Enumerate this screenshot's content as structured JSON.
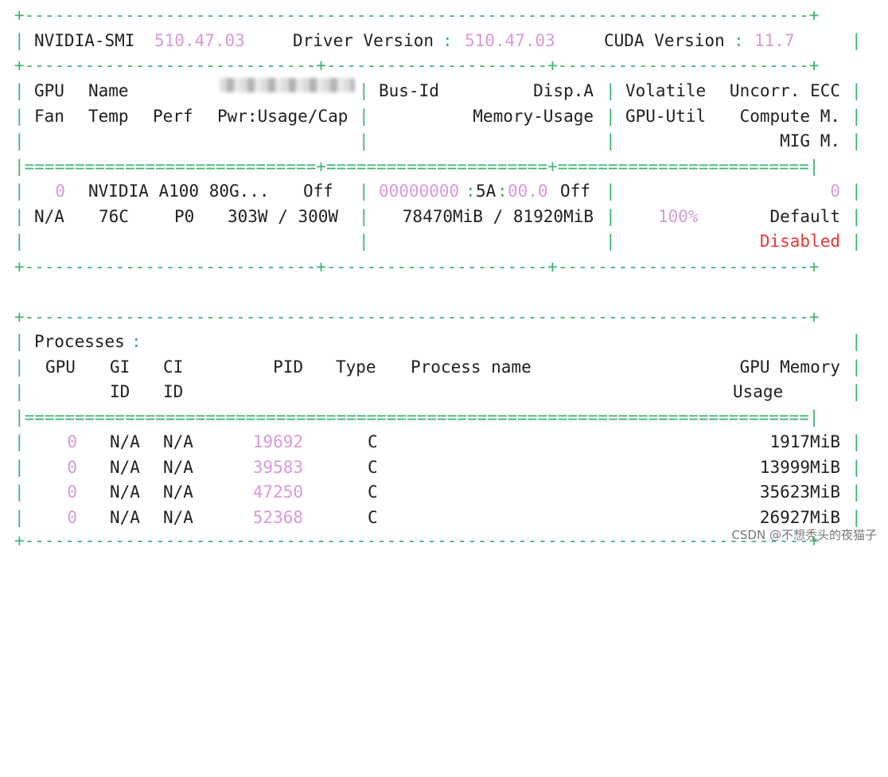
{
  "separators": {
    "dash": "+------------------------------------------------------------------------------+",
    "mid": "+-----------------------------+----------------------+-------------------------+",
    "equal": "|=============================+======================+=========================|",
    "equal_full": "|==============================================================================|"
  },
  "header": {
    "smi_label": "NVIDIA-SMI",
    "smi_version": "510.47.03",
    "driver_label": "Driver Version",
    "driver_version": "510.47.03",
    "cuda_label": "CUDA Version",
    "cuda_version": "11.7"
  },
  "gpu_table": {
    "col1_row1": [
      "GPU",
      "Name"
    ],
    "col1_row2": [
      "Fan",
      "Temp",
      "Perf",
      "Pwr:Usage/Cap"
    ],
    "col2_row1": [
      "Bus-Id",
      "Disp.A"
    ],
    "col2_row2": [
      "Memory-Usage"
    ],
    "col3_row1": [
      "Volatile",
      "Uncorr. ECC"
    ],
    "col3_row2": [
      "GPU-Util",
      "Compute M."
    ],
    "col3_row3": [
      "MIG M."
    ],
    "gpu": {
      "index": "0",
      "name": "NVIDIA A100 80G...",
      "persistence": "Off",
      "bus_id": "00000000:5A:00.0",
      "disp": "Off",
      "ecc": "0",
      "fan": "N/A",
      "temp": "76C",
      "perf": "P0",
      "power": "303W / 300W",
      "memory": "78470MiB / 81920MiB",
      "util": "100%",
      "compute_mode": "Default",
      "mig_mode": "Disabled"
    }
  },
  "processes": {
    "title": "Processes",
    "headers": {
      "gpu": "GPU",
      "gi": "GI",
      "ci": "CI",
      "gi_sub": "ID",
      "ci_sub": "ID",
      "pid": "PID",
      "type": "Type",
      "process_name": "Process name",
      "mem": "GPU Memory",
      "mem_sub": "Usage"
    },
    "rows": [
      {
        "gpu": "0",
        "gi": "N/A",
        "ci": "N/A",
        "pid": "19692",
        "type": "C",
        "name": "",
        "mem": "1917MiB"
      },
      {
        "gpu": "0",
        "gi": "N/A",
        "ci": "N/A",
        "pid": "39583",
        "type": "C",
        "name": "",
        "mem": "13999MiB"
      },
      {
        "gpu": "0",
        "gi": "N/A",
        "ci": "N/A",
        "pid": "47250",
        "type": "C",
        "name": "",
        "mem": "35623MiB"
      },
      {
        "gpu": "0",
        "gi": "N/A",
        "ci": "N/A",
        "pid": "52368",
        "type": "C",
        "name": "",
        "mem": "26927MiB"
      }
    ]
  },
  "watermark": "CSDN @不想秃头的夜猫子",
  "colors": {
    "separator": "#3cb371",
    "value": "#d99ad8",
    "disabled": "#e53935"
  }
}
